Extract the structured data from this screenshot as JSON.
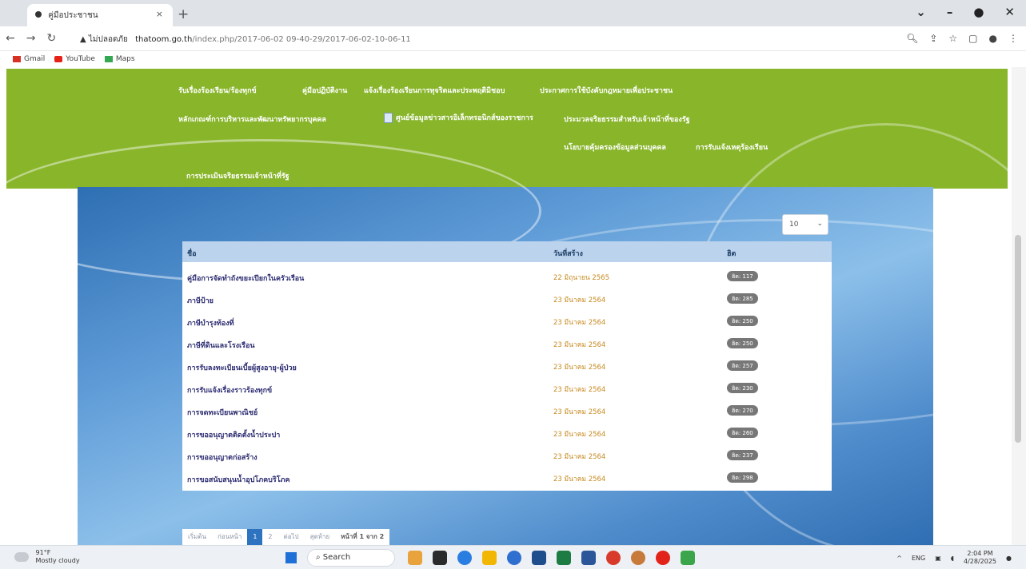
{
  "browser": {
    "tab_title": "คู่มือประชาชน",
    "tab_close": "×",
    "new_tab": "+",
    "url_warning": "▲ ไม่ปลอดภัย",
    "url_host": "thatoom.go.th",
    "url_path": "/index.php/2017-06-02 09-40-29/2017-06-02-10-06-11",
    "bookmarks": [
      "Gmail",
      "YouTube",
      "Maps"
    ]
  },
  "menu": {
    "row1": [
      "รับเรื่องร้องเรียน/ร้องทุกข์",
      "คู่มือปฏิบัติงาน",
      "แจ้งเรื่องร้องเรียนการทุจริตและประพฤติมิชอบ",
      "ประกาศการใช้บังคับกฎหมายเพื่อประชาชน"
    ],
    "row2": [
      "หลักเกณฑ์การบริหารและพัฒนาทรัพยากรบุคคล",
      "ศูนย์ข้อมูลข่าวสารอิเล็กทรอนิกส์ของราชการ",
      "ประมวลจริยธรรมสำหรับเจ้าหน้าที่ของรัฐ"
    ],
    "row3": [
      "นโยบายคุ้มครองข้อมูลส่วนบุคคล",
      "การรับแจ้งเหตุร้องเรียน"
    ],
    "row4": [
      "การประเมินจริยธรรมเจ้าหน้าที่รัฐ"
    ]
  },
  "list_limit": "10",
  "table": {
    "headers": [
      "ชื่อ",
      "วันที่สร้าง",
      "ฮิต"
    ],
    "rows": [
      {
        "name": "คู่มือการจัดทำถังขยะเปียกในครัวเรือน",
        "date": "22 มิถุนายน 2565",
        "hits": "ฮิต: 117"
      },
      {
        "name": "ภาษีป้าย",
        "date": "23 มีนาคม 2564",
        "hits": "ฮิต: 285"
      },
      {
        "name": "ภาษีบำรุงท้องที่",
        "date": "23 มีนาคม 2564",
        "hits": "ฮิต: 250"
      },
      {
        "name": "ภาษีที่ดินและโรงเรือน",
        "date": "23 มีนาคม 2564",
        "hits": "ฮิต: 250"
      },
      {
        "name": "การรับลงทะเบียนเบี้ยผู้สูงอายุ-ผู้ป่วย",
        "date": "23 มีนาคม 2564",
        "hits": "ฮิต: 257"
      },
      {
        "name": "การรับแจ้งเรื่องราวร้องทุกข์",
        "date": "23 มีนาคม 2564",
        "hits": "ฮิต: 230"
      },
      {
        "name": "การจดทะเบียนพาณิชย์",
        "date": "23 มีนาคม 2564",
        "hits": "ฮิต: 270"
      },
      {
        "name": "การขออนุญาตติดตั้งน้ำประปา",
        "date": "23 มีนาคม 2564",
        "hits": "ฮิต: 260"
      },
      {
        "name": "การขออนุญาตก่อสร้าง",
        "date": "23 มีนาคม 2564",
        "hits": "ฮิต: 237"
      },
      {
        "name": "การขอสนับสนุนน้ำอุปโภคบริโภค",
        "date": "23 มีนาคม 2564",
        "hits": "ฮิต: 298"
      }
    ]
  },
  "pagination": [
    "เริ่มต้น",
    "ก่อนหน้า",
    "1",
    "2",
    "ต่อไป",
    "สุดท้าย",
    "หน้าที่ 1 จาก 2"
  ],
  "taskbar": {
    "temp": "91°F",
    "weather": "Mostly cloudy",
    "search": "Search",
    "lang": "ENG",
    "time": "2:04 PM",
    "date": "4/28/2025"
  }
}
